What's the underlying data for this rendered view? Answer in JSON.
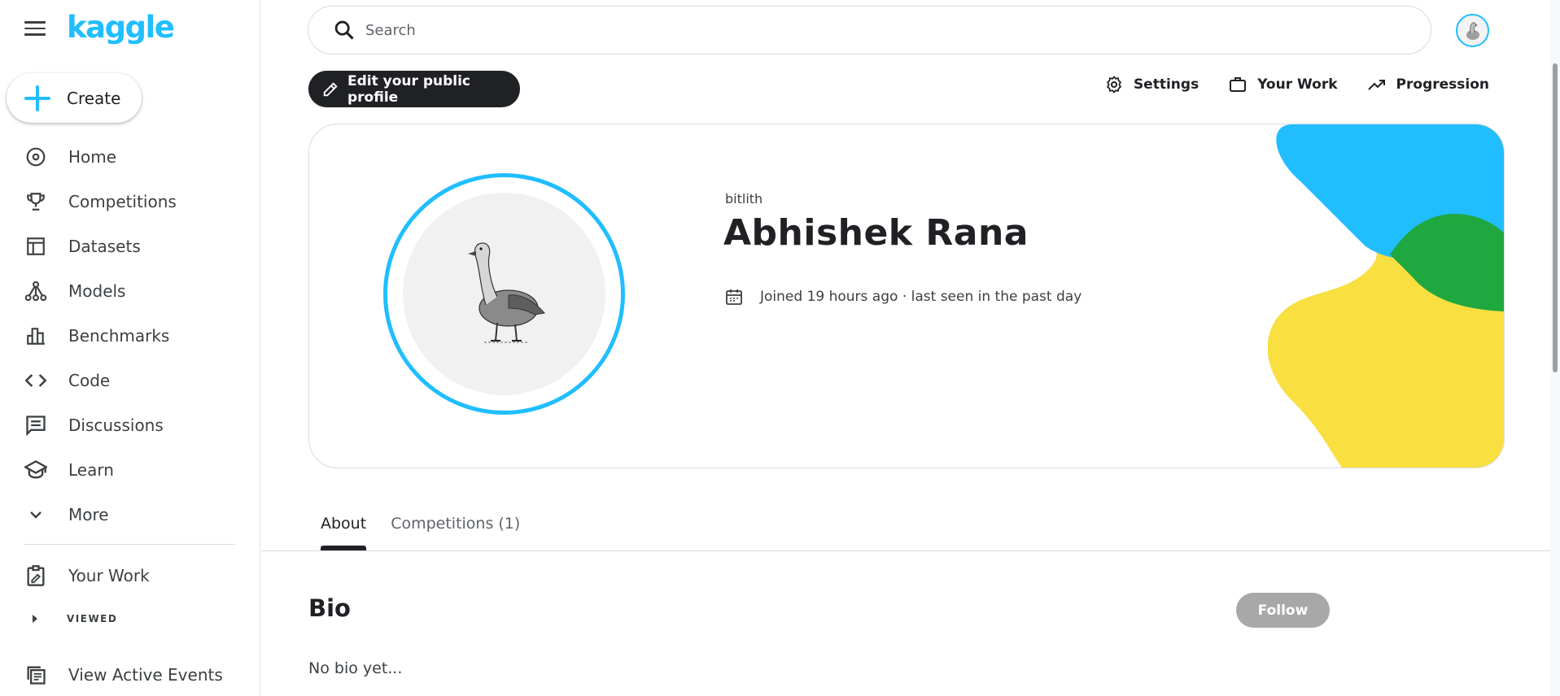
{
  "sidebar": {
    "logo": "kaggle",
    "create_label": "Create",
    "items": [
      {
        "label": "Home",
        "icon": "compass-icon"
      },
      {
        "label": "Competitions",
        "icon": "trophy-icon"
      },
      {
        "label": "Datasets",
        "icon": "table-icon"
      },
      {
        "label": "Models",
        "icon": "models-icon"
      },
      {
        "label": "Benchmarks",
        "icon": "bar-chart-icon"
      },
      {
        "label": "Code",
        "icon": "code-icon"
      },
      {
        "label": "Discussions",
        "icon": "comments-icon"
      },
      {
        "label": "Learn",
        "icon": "school-icon"
      },
      {
        "label": "More",
        "icon": "chevron-down-icon"
      }
    ],
    "your_work": "Your Work",
    "viewed": "VIEWED",
    "active_events": "View Active Events"
  },
  "search": {
    "placeholder": "Search"
  },
  "actions": {
    "edit_profile": "Edit your public profile",
    "settings": "Settings",
    "your_work": "Your Work",
    "progression": "Progression"
  },
  "profile": {
    "username": "bitlith",
    "name": "Abhishek Rana",
    "joined": "Joined 19 hours ago · last seen in the past day"
  },
  "tabs": [
    {
      "label": "About",
      "active": true
    },
    {
      "label": "Competitions (1)",
      "active": false
    }
  ],
  "about": {
    "bio_title": "Bio",
    "follow_label": "Follow",
    "bio_text": "No bio yet..."
  },
  "colors": {
    "accent": "#20beff",
    "deco_blue": "#20beff",
    "deco_green": "#20a840",
    "deco_yellow": "#f9df3f",
    "dark_button": "#202124",
    "disabled_button": "#a8a8a8"
  }
}
